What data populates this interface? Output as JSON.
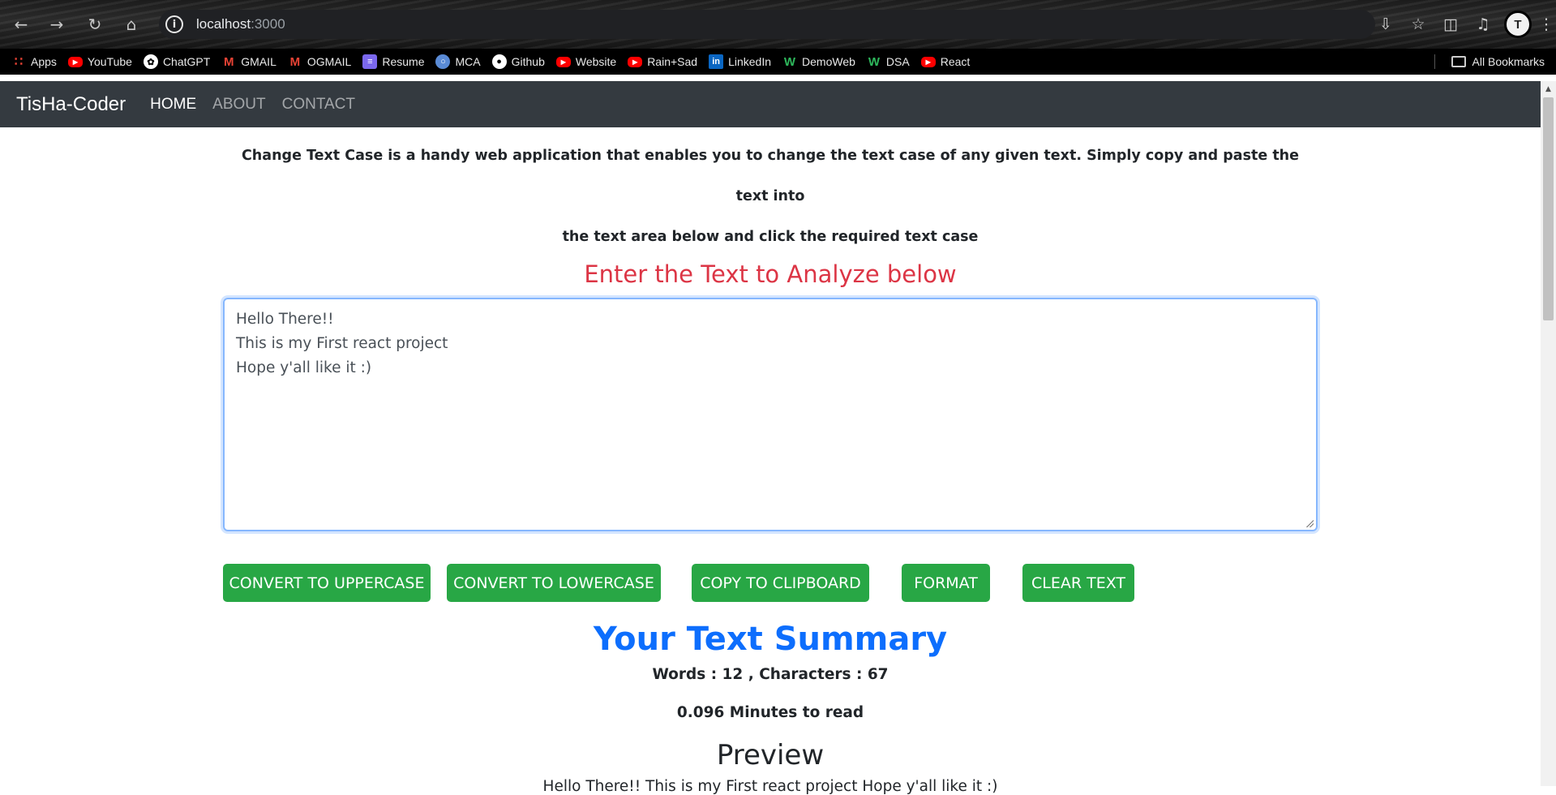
{
  "browser": {
    "url_host": "localhost",
    "url_port": ":3000",
    "nav_icons": [
      "back-icon",
      "forward-icon",
      "reload-icon",
      "home-icon"
    ],
    "right_icons": [
      "install-icon",
      "star-icon",
      "extensions-icon",
      "media-icon",
      "profile-avatar",
      "menu-icon"
    ]
  },
  "bookmarks": {
    "items": [
      {
        "label": "Apps",
        "icon": "apps-icon"
      },
      {
        "label": "YouTube",
        "icon": "youtube-icon"
      },
      {
        "label": "ChatGPT",
        "icon": "chatgpt-icon"
      },
      {
        "label": "GMAIL",
        "icon": "gmail-icon"
      },
      {
        "label": "OGMAIL",
        "icon": "gmail-icon"
      },
      {
        "label": "Resume",
        "icon": "resume-icon"
      },
      {
        "label": "MCA",
        "icon": "mca-icon"
      },
      {
        "label": "Github",
        "icon": "github-icon"
      },
      {
        "label": "Website",
        "icon": "youtube-icon"
      },
      {
        "label": "Rain+Sad",
        "icon": "youtube-icon"
      },
      {
        "label": "LinkedIn",
        "icon": "linkedin-icon"
      },
      {
        "label": "DemoWeb",
        "icon": "w-icon"
      },
      {
        "label": "DSA",
        "icon": "w-icon"
      },
      {
        "label": "React",
        "icon": "youtube-icon"
      }
    ],
    "all_bookmarks": "All Bookmarks"
  },
  "navbar": {
    "brand": "TisHa-Coder",
    "links": [
      {
        "label": "HOME",
        "active": true
      },
      {
        "label": "ABOUT",
        "active": false
      },
      {
        "label": "CONTACT",
        "active": false
      }
    ]
  },
  "main": {
    "intro_line1": "Change Text Case is a handy web application that enables you to change the text case of any given text. Simply copy and paste the text into",
    "intro_line2": "the text area below and click the required text case",
    "heading": "Enter the Text to Analyze below",
    "textarea_lines": [
      "Hello There!!",
      "This is my First react project",
      "Hope y'all like it :)"
    ],
    "buttons": {
      "uppercase": "CONVERT TO UPPERCASE",
      "lowercase": "CONVERT TO LOWERCASE",
      "copy": "COPY TO CLIPBOARD",
      "format": "FORMAT",
      "clear": "CLEAR TEXT"
    },
    "summary_title": "Your Text Summary",
    "word_char_stat": "Words : 12 , Characters : 67",
    "read_time": "0.096 Minutes to read",
    "preview_title": "Preview",
    "preview_text": "Hello There!! This is my First react project Hope y'all like it :)"
  },
  "colors": {
    "navbar_bg": "#343a40",
    "heading_red": "#dc3545",
    "button_green": "#28a745",
    "summary_blue": "#0d6efd"
  }
}
